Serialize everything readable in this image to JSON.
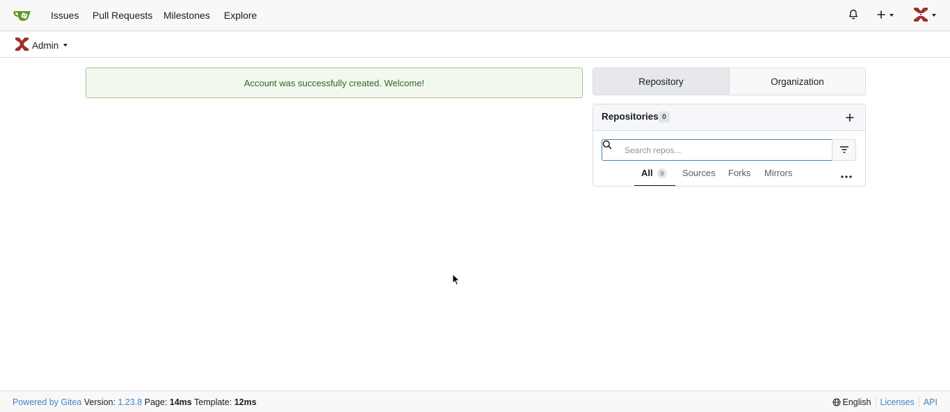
{
  "nav": {
    "logo": "gitea-logo-icon",
    "links": [
      "Issues",
      "Pull Requests",
      "Milestones",
      "Explore"
    ],
    "icons": [
      "bell-icon",
      "plus-icon",
      "avatar"
    ]
  },
  "context": {
    "user_label": "Admin"
  },
  "flash": {
    "message": "Account was successfully created. Welcome!"
  },
  "switch": {
    "tabs": [
      "Repository",
      "Organization"
    ],
    "active": "Repository"
  },
  "repos": {
    "title": "Repositories",
    "count": "0",
    "search_placeholder": "Search repos...",
    "tabs": [
      {
        "label": "All",
        "count": "0"
      },
      {
        "label": "Sources"
      },
      {
        "label": "Forks"
      },
      {
        "label": "Mirrors"
      }
    ]
  },
  "footer": {
    "powered_by": "Powered by Gitea",
    "version_label": "Version:",
    "version": "1.23.8",
    "page_label": "Page:",
    "page_time": "14ms",
    "template_label": "Template:",
    "template_time": "12ms",
    "language": "English",
    "licenses": "Licenses",
    "api": "API"
  },
  "colors": {
    "brand_green": "#609926",
    "link_blue": "#4183c4",
    "success_text": "#2c662d",
    "avatar_red": "#a0302a"
  }
}
